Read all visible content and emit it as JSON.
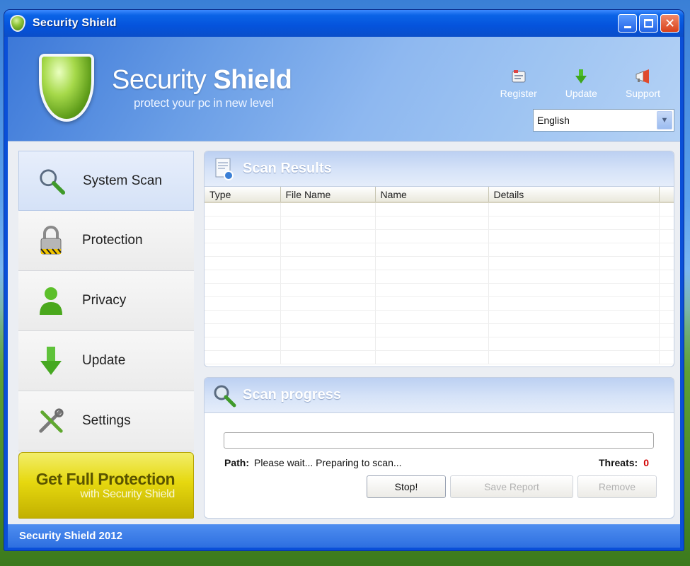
{
  "window": {
    "title": "Security Shield"
  },
  "header": {
    "brand_light": "Security ",
    "brand_bold": "Shield",
    "tagline": "protect your pc in new level",
    "actions": [
      {
        "label": "Register",
        "icon": "register-icon"
      },
      {
        "label": "Update",
        "icon": "update-arrow-icon"
      },
      {
        "label": "Support",
        "icon": "support-megaphone-icon"
      }
    ],
    "language": {
      "selected": "English"
    }
  },
  "sidebar": {
    "items": [
      {
        "label": "System Scan",
        "icon": "magnifier-icon",
        "active": true
      },
      {
        "label": "Protection",
        "icon": "padlock-icon"
      },
      {
        "label": "Privacy",
        "icon": "user-icon"
      },
      {
        "label": "Update",
        "icon": "down-arrow-icon"
      },
      {
        "label": "Settings",
        "icon": "tools-icon"
      }
    ],
    "promo": {
      "line1": "Get Full Protection",
      "line2": "with Security Shield"
    }
  },
  "results": {
    "title": "Scan Results",
    "columns": [
      "Type",
      "File Name",
      "Name",
      "Details"
    ],
    "rows": []
  },
  "progress": {
    "title": "Scan progress",
    "percent": 0,
    "path_label": "Path:",
    "path_value": "Please wait... Preparing to scan...",
    "threats_label": "Threats:",
    "threats_count": "0",
    "buttons": {
      "stop": "Stop!",
      "save_report": "Save Report",
      "remove": "Remove"
    }
  },
  "status": {
    "text": "Security Shield 2012"
  },
  "colors": {
    "accent": "#0a4fd8",
    "threat_count": "#d10000",
    "promo": "#e6d80f",
    "shield_green": "#8fc43a"
  }
}
